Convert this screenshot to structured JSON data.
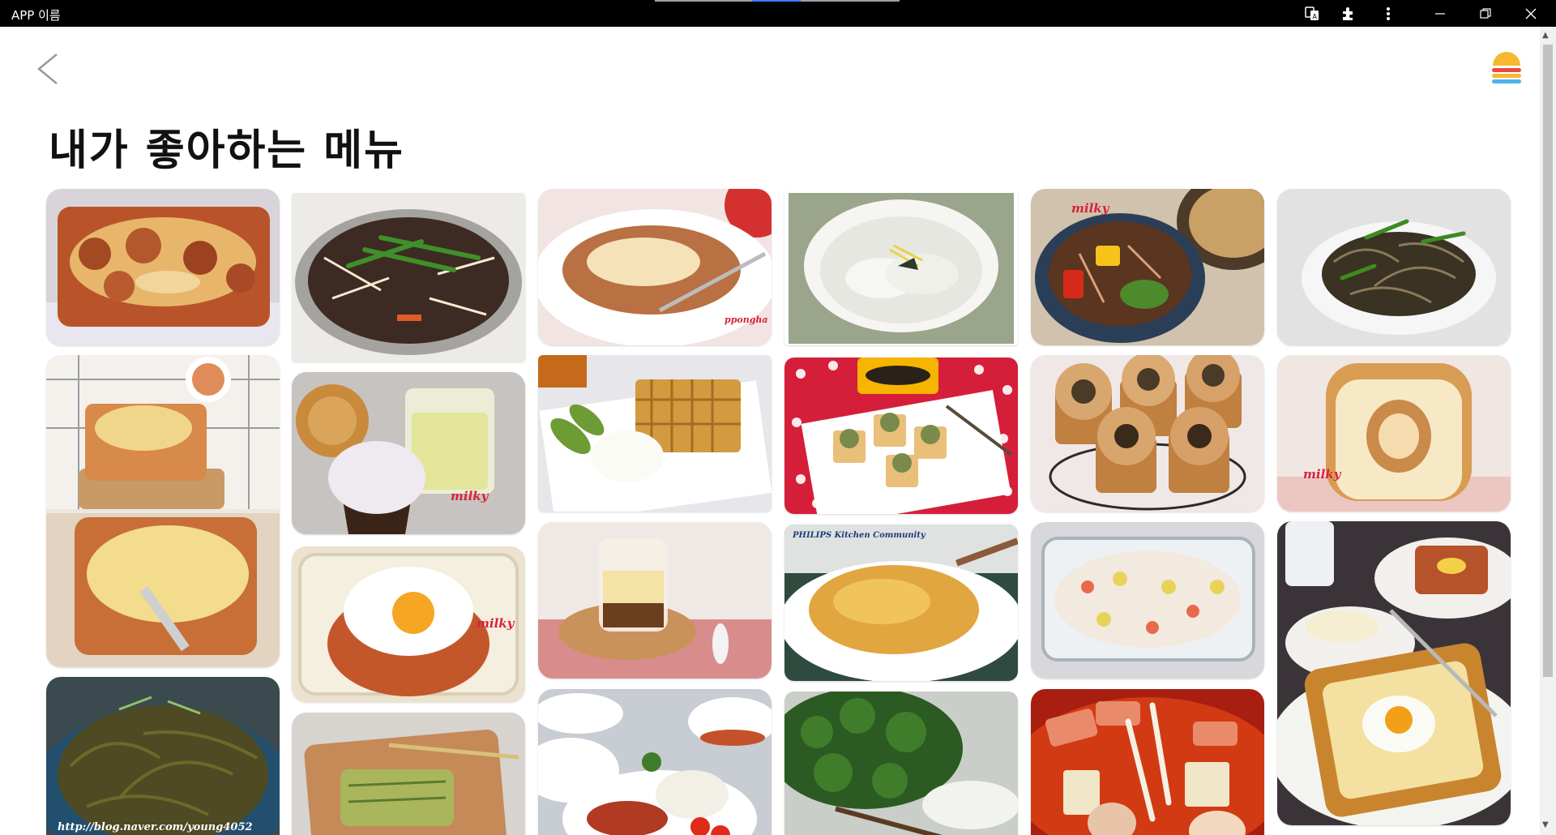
{
  "window": {
    "app_title": "APP 이름",
    "controls": [
      "translate-icon",
      "extensions-icon",
      "more-icon",
      "minimize-icon",
      "restore-icon",
      "close-icon"
    ]
  },
  "header": {
    "back_icon": "chevron-left-icon",
    "menu_icon": "burger-logo-icon",
    "title": "내가 좋아하는 메뉴"
  },
  "gallery": {
    "columns": [
      {
        "items": [
          {
            "name": "meatball-cheese-bake"
          },
          {
            "name": "lasagna"
          },
          {
            "name": "seasoned-greens",
            "watermark": "http://blog.naver.com/young4052"
          }
        ]
      },
      {
        "items": [
          {
            "name": "mushroom-beef-hotpot"
          },
          {
            "name": "cupcake-and-juice",
            "watermark": "milky"
          },
          {
            "name": "fried-egg-rice-cake",
            "watermark": "milky"
          },
          {
            "name": "chive-pancake"
          }
        ]
      },
      {
        "items": [
          {
            "name": "cheese-pasta-plate",
            "watermark": "ppongha"
          },
          {
            "name": "waffle-with-cream"
          },
          {
            "name": "pudding-jar"
          },
          {
            "name": "rice-and-fish-table"
          }
        ]
      },
      {
        "items": [
          {
            "name": "dumpling-soup"
          },
          {
            "name": "stuffed-tofu-bites"
          },
          {
            "name": "potato-pancake",
            "watermark": "PHILIPS Kitchen Community"
          },
          {
            "name": "herb-plant"
          }
        ]
      },
      {
        "items": [
          {
            "name": "stir-fried-vegetables",
            "watermark": "milky"
          },
          {
            "name": "muffin-rolls"
          },
          {
            "name": "gratin-glass-dish"
          },
          {
            "name": "spicy-stew"
          }
        ]
      },
      {
        "items": [
          {
            "name": "anchovy-stir-fry"
          },
          {
            "name": "bread-loaf",
            "watermark": "milky"
          },
          {
            "name": "egg-toast-breakfast"
          }
        ]
      }
    ]
  },
  "colors": {
    "titlebar_bg": "#000000",
    "burger_top": "#f5b82e",
    "burger_mid": "#e74c3c",
    "burger_bottom": "#4fb3e6",
    "watermark_red": "#d6223a"
  }
}
